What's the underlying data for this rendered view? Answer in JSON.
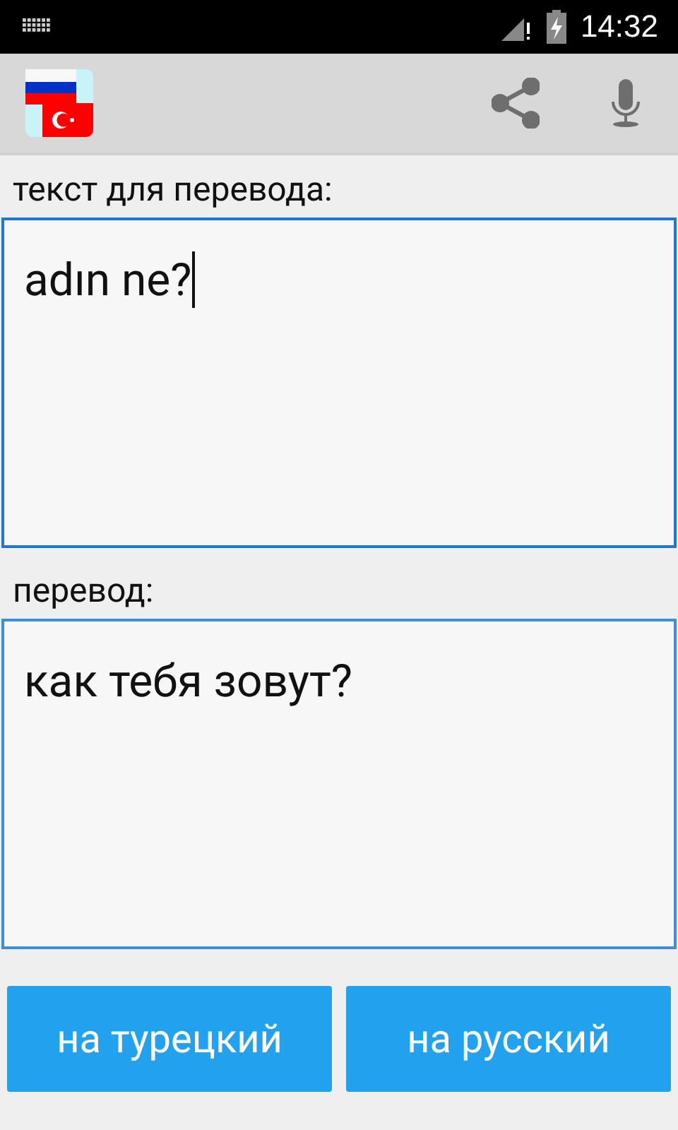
{
  "status_bar": {
    "time": "14:32"
  },
  "source": {
    "label": "текст для перевода:",
    "value": "adın ne?",
    "focused": true
  },
  "result": {
    "label": "перевод:",
    "value": "как тебя зовут?"
  },
  "buttons": [
    {
      "label": "на турецкий"
    },
    {
      "label": "на русский"
    }
  ]
}
